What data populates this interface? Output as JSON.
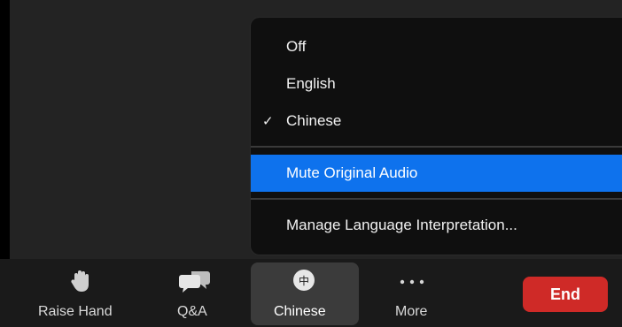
{
  "interpretation_menu": {
    "items": [
      {
        "label": "Off",
        "checked": false
      },
      {
        "label": "English",
        "checked": false
      },
      {
        "label": "Chinese",
        "checked": true
      }
    ],
    "check_glyph": "✓",
    "mute_original_audio_label": "Mute Original Audio",
    "manage_label": "Manage Language Interpretation..."
  },
  "toolbar": {
    "raise_hand_label": "Raise Hand",
    "qa_label": "Q&A",
    "language_label": "Chinese",
    "language_icon_text": "中",
    "more_label": "More",
    "end_label": "End"
  },
  "colors": {
    "menu_highlight": "#0e72ed",
    "end_button": "#cf2a27",
    "toolbar_bg": "#1a1a1a"
  },
  "icons": {
    "raise_hand": "hand-icon",
    "qa": "chat-bubbles-icon",
    "language": "globe-chinese-icon",
    "more": "ellipsis-icon"
  }
}
